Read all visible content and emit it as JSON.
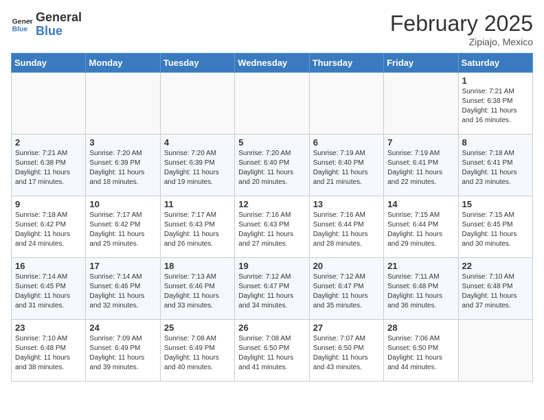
{
  "header": {
    "logo_line1": "General",
    "logo_line2": "Blue",
    "month_year": "February 2025",
    "location": "Zipiajo, Mexico"
  },
  "days_of_week": [
    "Sunday",
    "Monday",
    "Tuesday",
    "Wednesday",
    "Thursday",
    "Friday",
    "Saturday"
  ],
  "weeks": [
    [
      {
        "day": "",
        "info": ""
      },
      {
        "day": "",
        "info": ""
      },
      {
        "day": "",
        "info": ""
      },
      {
        "day": "",
        "info": ""
      },
      {
        "day": "",
        "info": ""
      },
      {
        "day": "",
        "info": ""
      },
      {
        "day": "1",
        "info": "Sunrise: 7:21 AM\nSunset: 6:38 PM\nDaylight: 11 hours and 16 minutes."
      }
    ],
    [
      {
        "day": "2",
        "info": "Sunrise: 7:21 AM\nSunset: 6:38 PM\nDaylight: 11 hours and 17 minutes."
      },
      {
        "day": "3",
        "info": "Sunrise: 7:20 AM\nSunset: 6:39 PM\nDaylight: 11 hours and 18 minutes."
      },
      {
        "day": "4",
        "info": "Sunrise: 7:20 AM\nSunset: 6:39 PM\nDaylight: 11 hours and 19 minutes."
      },
      {
        "day": "5",
        "info": "Sunrise: 7:20 AM\nSunset: 6:40 PM\nDaylight: 11 hours and 20 minutes."
      },
      {
        "day": "6",
        "info": "Sunrise: 7:19 AM\nSunset: 6:40 PM\nDaylight: 11 hours and 21 minutes."
      },
      {
        "day": "7",
        "info": "Sunrise: 7:19 AM\nSunset: 6:41 PM\nDaylight: 11 hours and 22 minutes."
      },
      {
        "day": "8",
        "info": "Sunrise: 7:18 AM\nSunset: 6:41 PM\nDaylight: 11 hours and 23 minutes."
      }
    ],
    [
      {
        "day": "9",
        "info": "Sunrise: 7:18 AM\nSunset: 6:42 PM\nDaylight: 11 hours and 24 minutes."
      },
      {
        "day": "10",
        "info": "Sunrise: 7:17 AM\nSunset: 6:42 PM\nDaylight: 11 hours and 25 minutes."
      },
      {
        "day": "11",
        "info": "Sunrise: 7:17 AM\nSunset: 6:43 PM\nDaylight: 11 hours and 26 minutes."
      },
      {
        "day": "12",
        "info": "Sunrise: 7:16 AM\nSunset: 6:43 PM\nDaylight: 11 hours and 27 minutes."
      },
      {
        "day": "13",
        "info": "Sunrise: 7:16 AM\nSunset: 6:44 PM\nDaylight: 11 hours and 28 minutes."
      },
      {
        "day": "14",
        "info": "Sunrise: 7:15 AM\nSunset: 6:44 PM\nDaylight: 11 hours and 29 minutes."
      },
      {
        "day": "15",
        "info": "Sunrise: 7:15 AM\nSunset: 6:45 PM\nDaylight: 11 hours and 30 minutes."
      }
    ],
    [
      {
        "day": "16",
        "info": "Sunrise: 7:14 AM\nSunset: 6:45 PM\nDaylight: 11 hours and 31 minutes."
      },
      {
        "day": "17",
        "info": "Sunrise: 7:14 AM\nSunset: 6:46 PM\nDaylight: 11 hours and 32 minutes."
      },
      {
        "day": "18",
        "info": "Sunrise: 7:13 AM\nSunset: 6:46 PM\nDaylight: 11 hours and 33 minutes."
      },
      {
        "day": "19",
        "info": "Sunrise: 7:12 AM\nSunset: 6:47 PM\nDaylight: 11 hours and 34 minutes."
      },
      {
        "day": "20",
        "info": "Sunrise: 7:12 AM\nSunset: 6:47 PM\nDaylight: 11 hours and 35 minutes."
      },
      {
        "day": "21",
        "info": "Sunrise: 7:11 AM\nSunset: 6:48 PM\nDaylight: 11 hours and 36 minutes."
      },
      {
        "day": "22",
        "info": "Sunrise: 7:10 AM\nSunset: 6:48 PM\nDaylight: 11 hours and 37 minutes."
      }
    ],
    [
      {
        "day": "23",
        "info": "Sunrise: 7:10 AM\nSunset: 6:48 PM\nDaylight: 11 hours and 38 minutes."
      },
      {
        "day": "24",
        "info": "Sunrise: 7:09 AM\nSunset: 6:49 PM\nDaylight: 11 hours and 39 minutes."
      },
      {
        "day": "25",
        "info": "Sunrise: 7:08 AM\nSunset: 6:49 PM\nDaylight: 11 hours and 40 minutes."
      },
      {
        "day": "26",
        "info": "Sunrise: 7:08 AM\nSunset: 6:50 PM\nDaylight: 11 hours and 41 minutes."
      },
      {
        "day": "27",
        "info": "Sunrise: 7:07 AM\nSunset: 6:50 PM\nDaylight: 11 hours and 43 minutes."
      },
      {
        "day": "28",
        "info": "Sunrise: 7:06 AM\nSunset: 6:50 PM\nDaylight: 11 hours and 44 minutes."
      },
      {
        "day": "",
        "info": ""
      }
    ]
  ]
}
